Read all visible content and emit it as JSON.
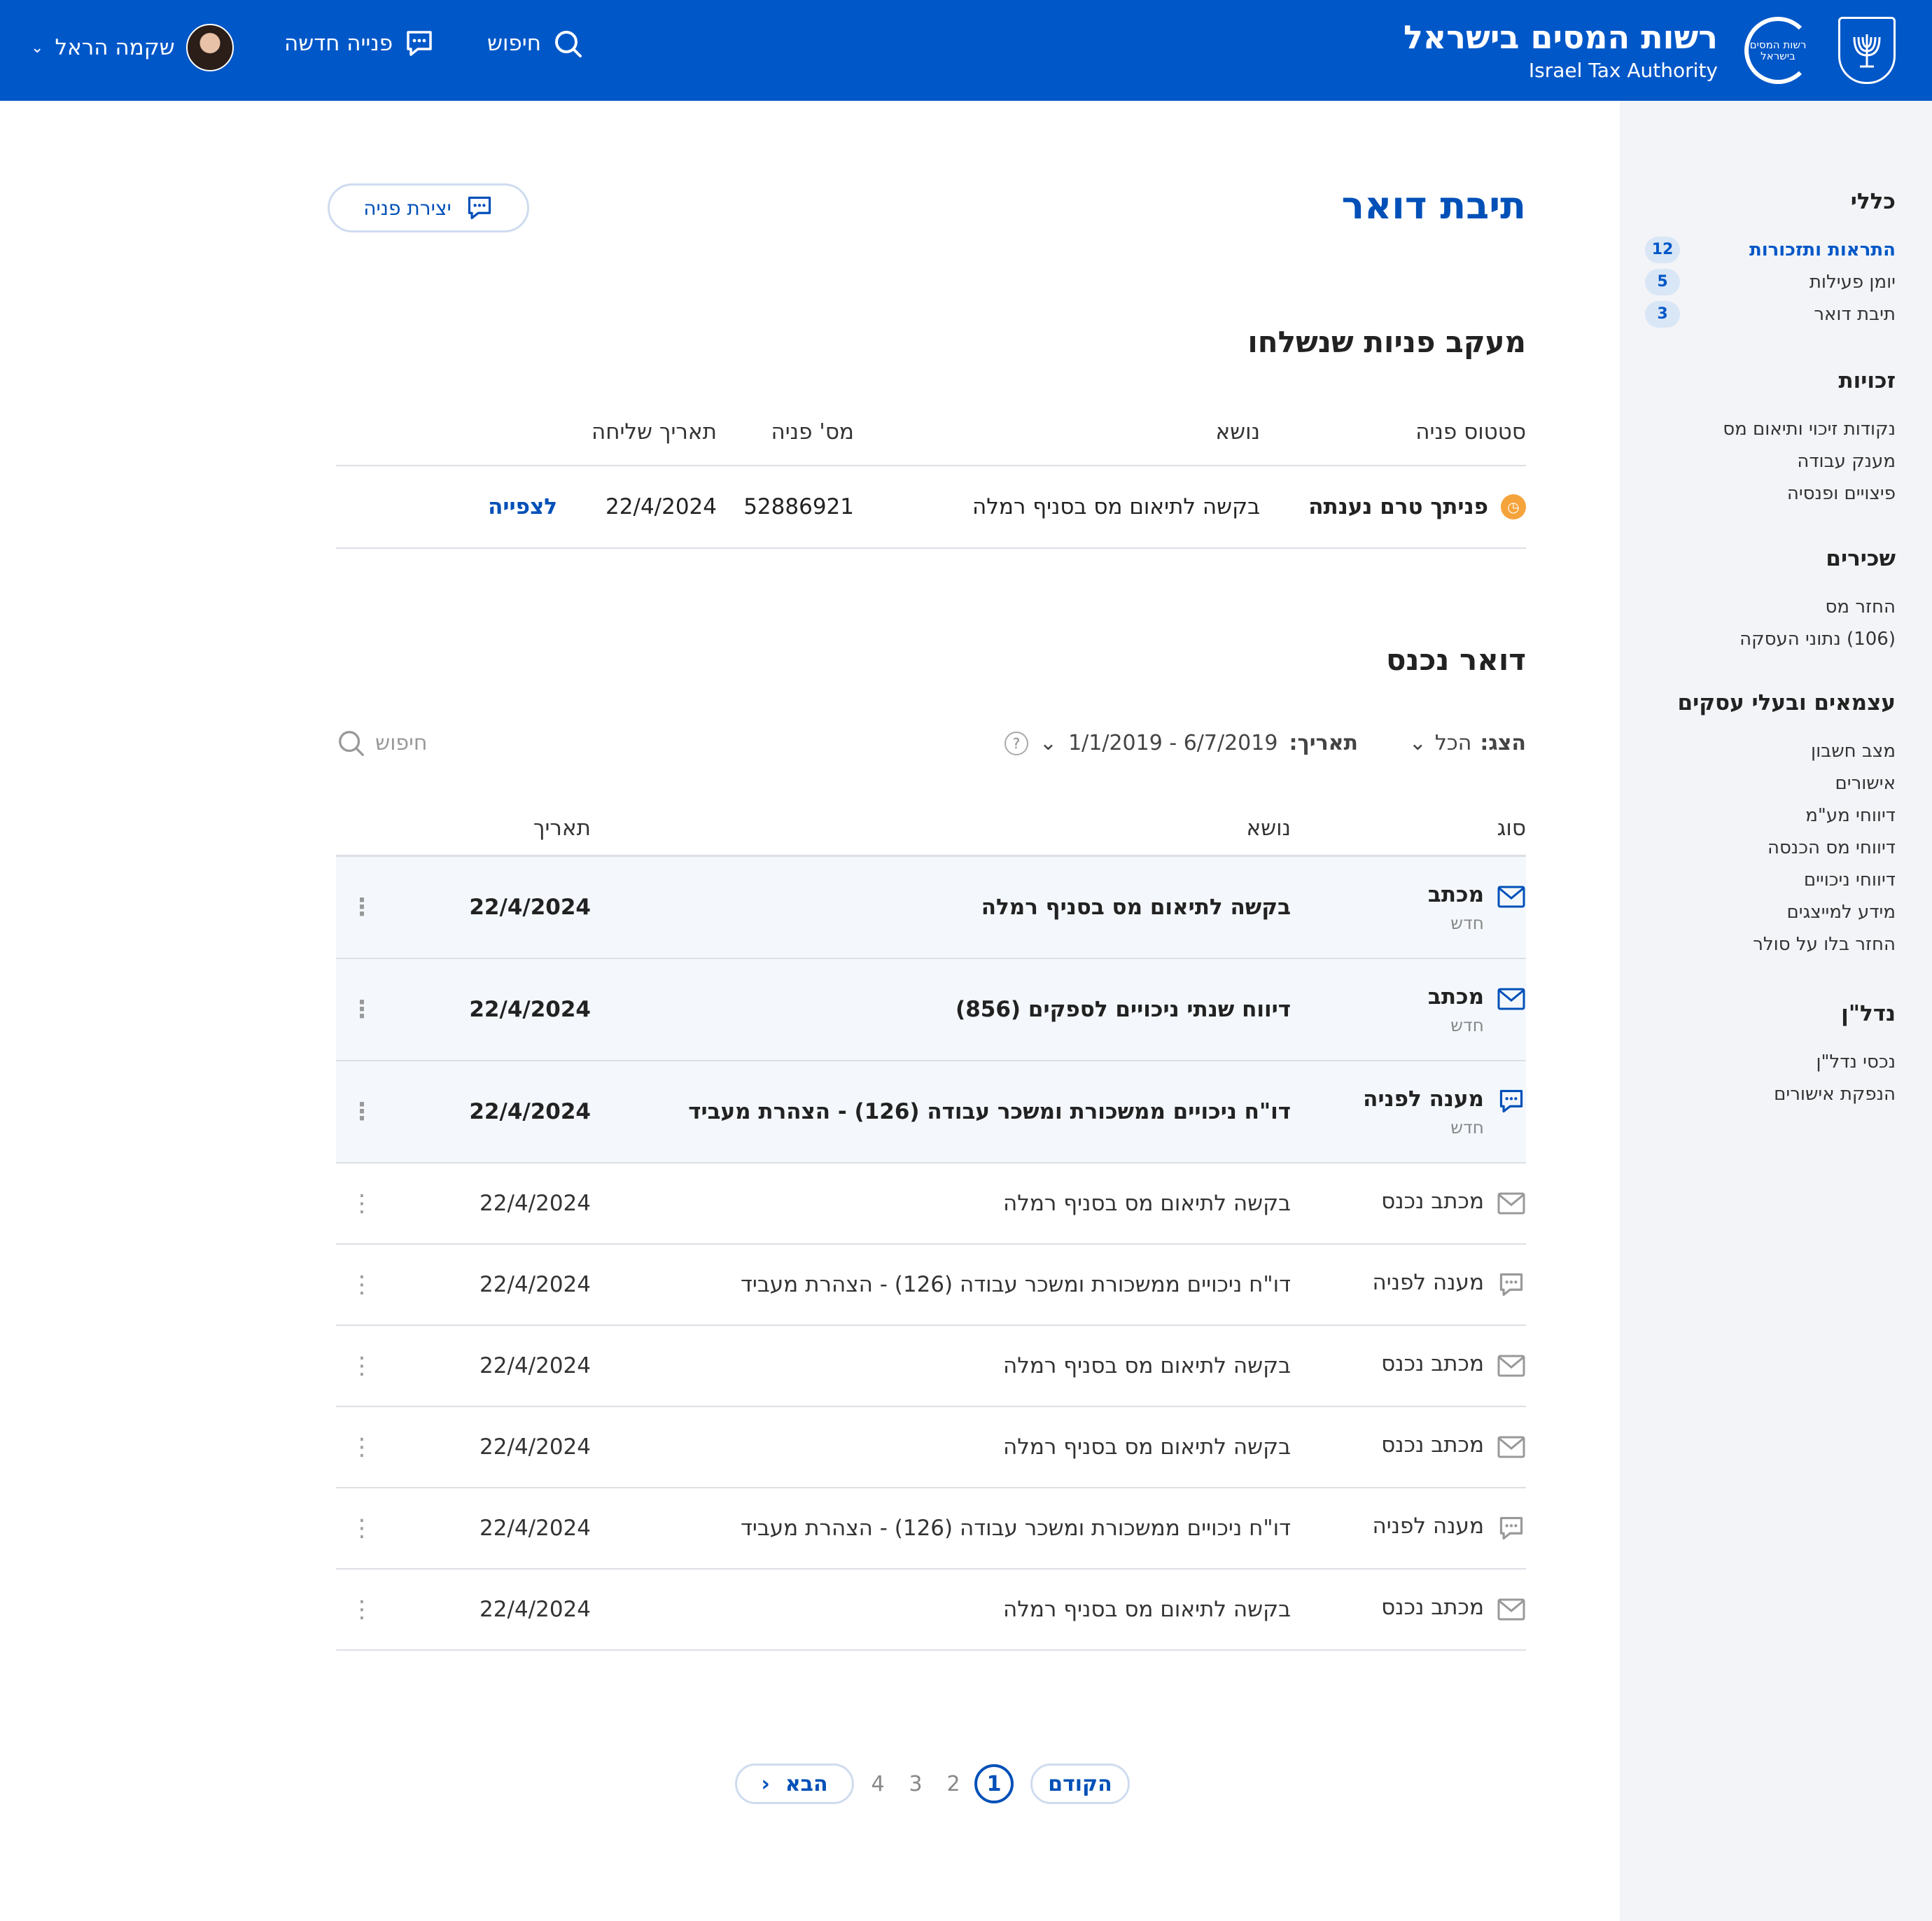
{
  "header": {
    "title_he": "רשות המסים בישראל",
    "title_en": "Israel Tax Authority",
    "logo_text": "רשות המסים בישראל",
    "search_label": "חיפוש",
    "new_inquiry_label": "פנייה חדשה",
    "user_name": "שקמה הראל",
    "brand_color": "#0057c8"
  },
  "sidebar": {
    "groups": [
      {
        "title": "כללי",
        "items": [
          {
            "label": "התראות ותזכורות",
            "count": "12",
            "active": true
          },
          {
            "label": "יומן פעילות",
            "count": "5"
          },
          {
            "label": "תיבת דואר",
            "count": "3"
          }
        ]
      },
      {
        "title": "זכויות",
        "items": [
          {
            "label": "נקודות זיכוי ותיאום מס"
          },
          {
            "label": "מענק עבודה"
          },
          {
            "label": "פיצויים ופנסיה"
          }
        ]
      },
      {
        "title": "שכירים",
        "items": [
          {
            "label": "החזר מס"
          },
          {
            "label": "(106) נתוני העסקה"
          }
        ]
      },
      {
        "title": "עצמאים ובעלי עסקים",
        "items": [
          {
            "label": "מצב חשבון"
          },
          {
            "label": "אישורים"
          },
          {
            "label": "דיווחי מע\"מ"
          },
          {
            "label": "דיווחי מס הכנסה"
          },
          {
            "label": "דיווחי ניכויים"
          },
          {
            "label": "מידע למייצגים"
          },
          {
            "label": "החזר בלו על סולר"
          }
        ]
      },
      {
        "title": "נדל\"ן",
        "items": [
          {
            "label": "נכסי נדל\"ן"
          },
          {
            "label": "הנפקת אישורים"
          }
        ]
      }
    ]
  },
  "page": {
    "title": "תיבת דואר",
    "create_button": "יצירת פניה"
  },
  "tracking": {
    "title": "מעקב פניות שנשלחו",
    "columns": {
      "status": "סטטוס פניה",
      "topic": "נושא",
      "number": "מס' פניה",
      "date": "תאריך שליחה"
    },
    "row": {
      "status": "פניתך טרם נענתה",
      "topic": "בקשה לתיאום מס בסניף רמלה",
      "number": "52886921",
      "date": "22/4/2024",
      "action": "לצפייה",
      "status_color": "#f5a33b"
    }
  },
  "inbox": {
    "title": "דואר נכנס",
    "filter_show_label": "הצג:",
    "filter_show_value": "הכל",
    "filter_date_label": "תאריך:",
    "filter_date_value": "1/1/2019 - 6/7/2019",
    "search_placeholder": "חיפוש",
    "columns": {
      "type": "סוג",
      "topic": "נושא",
      "date": "תאריך"
    },
    "rows": [
      {
        "type": "מכתב",
        "icon": "envelope-icon",
        "sub": "חדש",
        "topic": "בקשה לתיאום מס בסניף רמלה",
        "date": "22/4/2024",
        "unread": true
      },
      {
        "type": "מכתב",
        "icon": "envelope-icon",
        "sub": "חדש",
        "topic": "דיווח שנתי ניכויים לספקים (856)",
        "date": "22/4/2024",
        "unread": true
      },
      {
        "type": "מענה לפניה",
        "icon": "chat-icon",
        "sub": "חדש",
        "topic": "דו\"ח ניכויים ממשכורת ומשכר עבודה (126) - הצהרת מעביד",
        "date": "22/4/2024",
        "unread": true
      },
      {
        "type": "מכתב נכנס",
        "icon": "envelope-icon",
        "topic": "בקשה לתיאום מס בסניף רמלה",
        "date": "22/4/2024"
      },
      {
        "type": "מענה לפניה",
        "icon": "chat-icon",
        "topic": "דו\"ח ניכויים ממשכורת ומשכר עבודה (126) - הצהרת מעביד",
        "date": "22/4/2024"
      },
      {
        "type": "מכתב נכנס",
        "icon": "envelope-icon",
        "topic": "בקשה לתיאום מס בסניף רמלה",
        "date": "22/4/2024"
      },
      {
        "type": "מכתב נכנס",
        "icon": "envelope-icon",
        "topic": "בקשה לתיאום מס בסניף רמלה",
        "date": "22/4/2024"
      },
      {
        "type": "מענה לפניה",
        "icon": "chat-icon",
        "topic": "דו\"ח ניכויים ממשכורת ומשכר עבודה (126) - הצהרת מעביד",
        "date": "22/4/2024"
      },
      {
        "type": "מכתב נכנס",
        "icon": "envelope-icon",
        "topic": "בקשה לתיאום מס בסניף רמלה",
        "date": "22/4/2024"
      }
    ]
  },
  "pagination": {
    "prev_label": "הקודם",
    "next_label": "הבא",
    "pages": [
      "1",
      "2",
      "3",
      "4"
    ],
    "current": "1"
  }
}
